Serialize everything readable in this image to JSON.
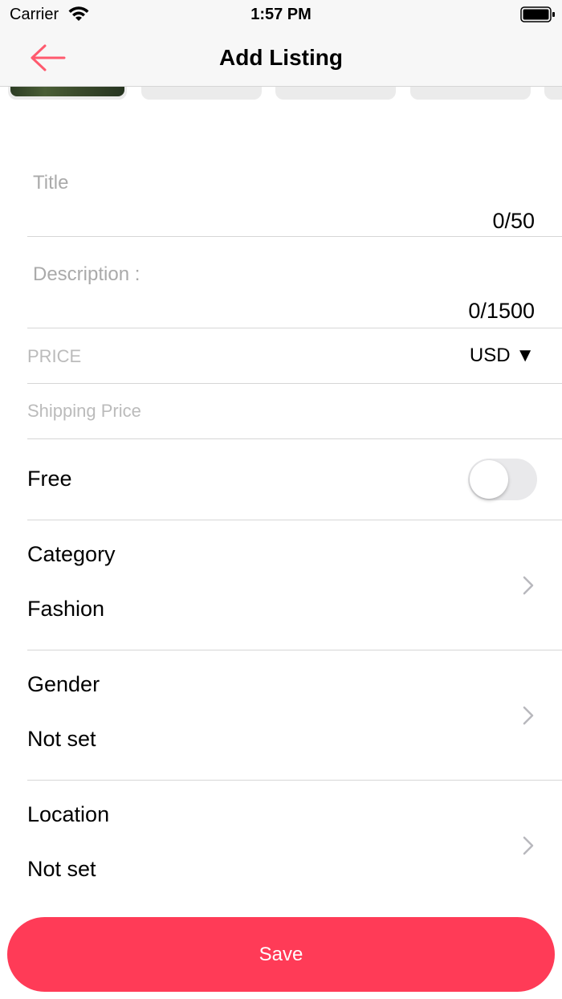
{
  "status_bar": {
    "carrier": "Carrier",
    "time": "1:57 PM"
  },
  "nav": {
    "title": "Add Listing",
    "back_icon": "arrow-left-icon",
    "accent_color": "#ff5a6e"
  },
  "image_strip": {
    "thumbnails": [
      "photo",
      "empty",
      "empty",
      "empty",
      "empty"
    ]
  },
  "form": {
    "title_field": {
      "placeholder": "Title",
      "counter": "0/50"
    },
    "description_field": {
      "placeholder": "Description :",
      "counter": "0/1500"
    },
    "price_field": {
      "placeholder": "PRICE",
      "currency": "USD ▼"
    },
    "shipping_field": {
      "placeholder": "Shipping Price"
    },
    "free_row": {
      "label": "Free",
      "toggle_on": false
    },
    "category_row": {
      "label": "Category",
      "value": "Fashion"
    },
    "gender_row": {
      "label": "Gender",
      "value": "Not set"
    },
    "location_row": {
      "label": "Location",
      "value": "Not set"
    }
  },
  "save_button": {
    "label": "Save",
    "color": "#ff3b57"
  }
}
